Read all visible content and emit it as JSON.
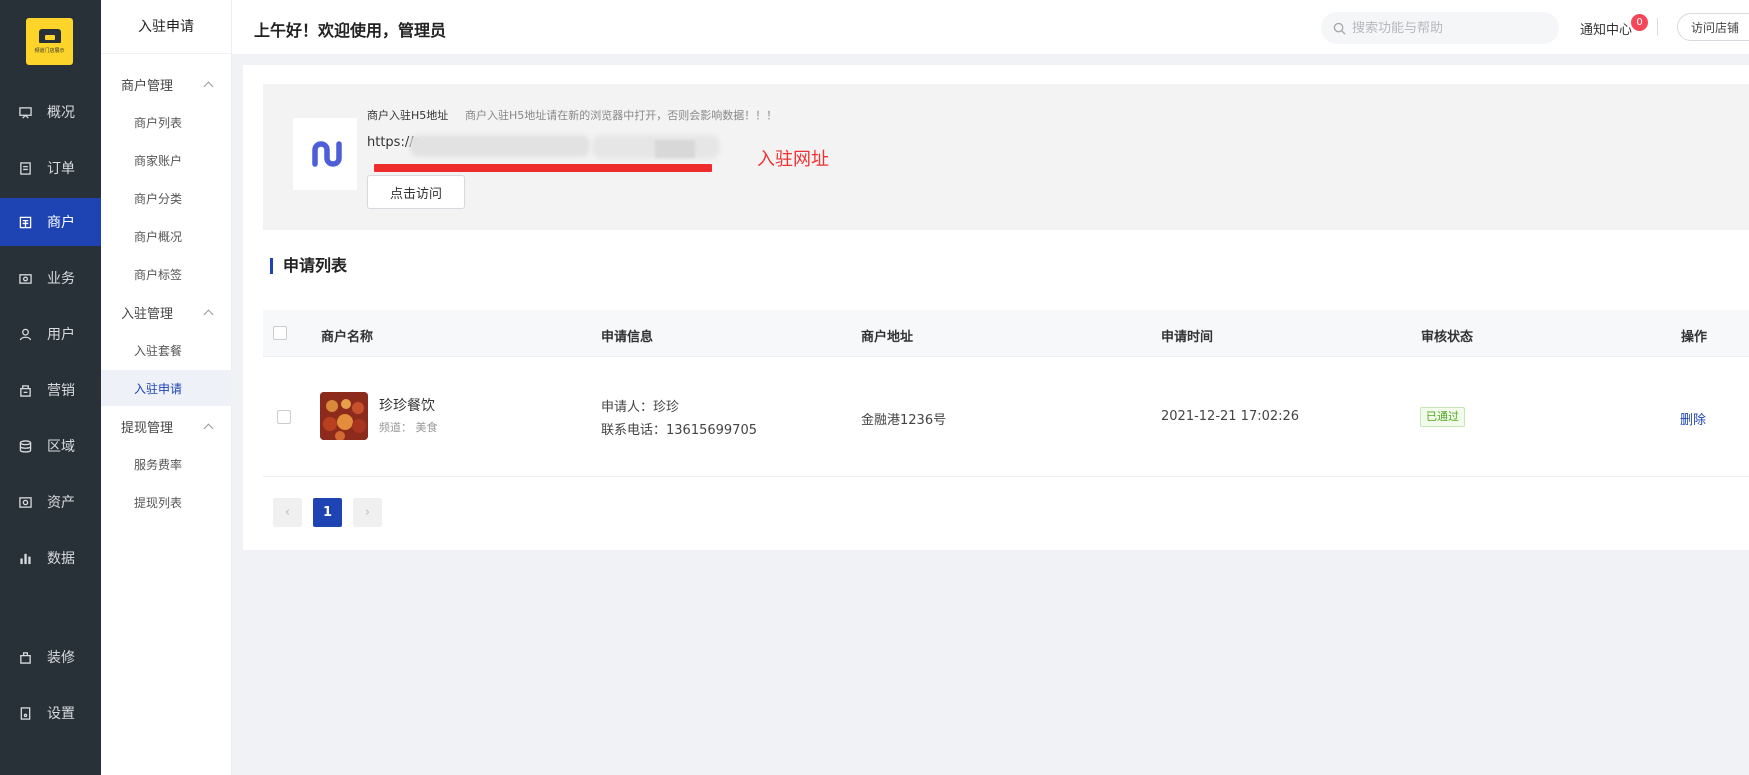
{
  "logo": {
    "text": "频道门店展示"
  },
  "sidebar": {
    "items": [
      {
        "label": "概况",
        "icon": "overview-icon"
      },
      {
        "label": "订单",
        "icon": "order-icon"
      },
      {
        "label": "商户",
        "icon": "merchant-icon"
      },
      {
        "label": "业务",
        "icon": "business-icon"
      },
      {
        "label": "用户",
        "icon": "user-icon"
      },
      {
        "label": "营销",
        "icon": "marketing-icon"
      },
      {
        "label": "区域",
        "icon": "region-icon"
      },
      {
        "label": "资产",
        "icon": "asset-icon"
      },
      {
        "label": "数据",
        "icon": "data-icon"
      },
      {
        "label": "装修",
        "icon": "decorate-icon"
      },
      {
        "label": "设置",
        "icon": "settings-icon"
      }
    ],
    "active": "商户"
  },
  "subnav": {
    "title": "入驻申请",
    "groups": [
      {
        "label": "商户管理",
        "items": [
          "商户列表",
          "商家账户",
          "商户分类",
          "商户概况",
          "商户标签"
        ]
      },
      {
        "label": "入驻管理",
        "items": [
          "入驻套餐",
          "入驻申请"
        ]
      },
      {
        "label": "提现管理",
        "items": [
          "服务费率",
          "提现列表"
        ]
      }
    ],
    "active": "入驻申请"
  },
  "header": {
    "greeting": "上午好！欢迎使用，管理员",
    "search_placeholder": "搜索功能与帮助",
    "notify_label": "通知中心",
    "notify_count": "0",
    "visit_store": "访问店铺"
  },
  "h5": {
    "label": "商户入驻H5地址",
    "tip": "商户入驻H5地址请在新的浏览器中打开，否则会影响数据！！！",
    "url_prefix": "https://c",
    "annotation": "入驻网址",
    "visit_button": "点击访问"
  },
  "list": {
    "title": "申请列表",
    "columns": [
      "商户名称",
      "申请信息",
      "商户地址",
      "申请时间",
      "审核状态",
      "操作"
    ],
    "rows": [
      {
        "name": "珍珍餐饮",
        "channel": "频道： 美食",
        "applicant": "申请人：珍珍",
        "phone": "联系电话：13615699705",
        "address": "金融港1236号",
        "time": "2021-12-21 17:02:26",
        "status": "已通过",
        "action": "删除"
      }
    ]
  },
  "pagination": {
    "current": "1",
    "prev": "‹",
    "next": "›"
  },
  "colors": {
    "accent": "#1e44b3",
    "sidebar_bg": "#283038",
    "logo_bg": "#fdd42a",
    "success": "#4fa81f",
    "danger": "#ee2c2c"
  }
}
